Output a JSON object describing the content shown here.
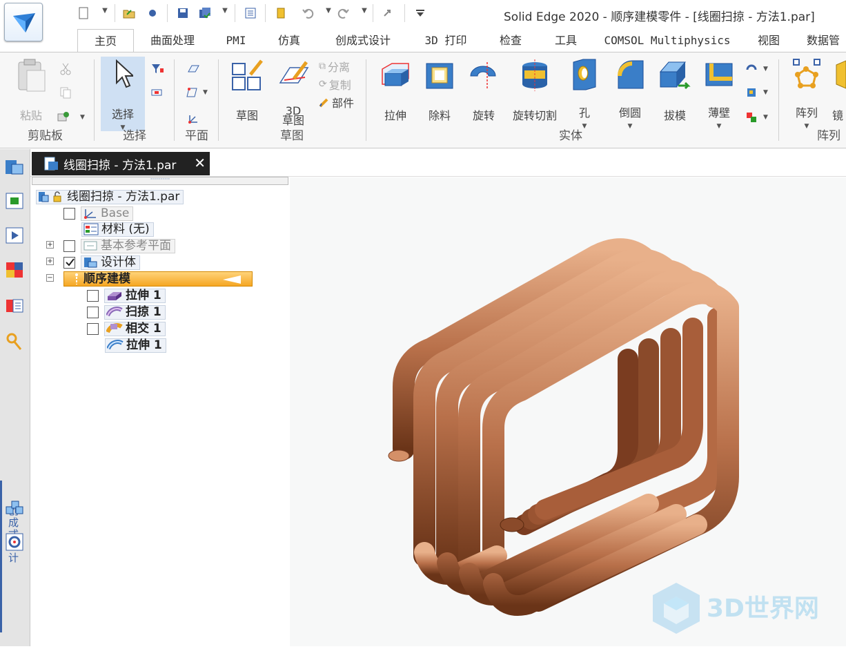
{
  "window": {
    "title": "Solid Edge 2020 - 顺序建模零件 - [线圈扫掠 - 方法1.par]"
  },
  "quick_access": [
    "new-icon",
    "open-icon",
    "print-icon",
    "save-icon",
    "save-all-icon",
    "properties-icon",
    "file-icon",
    "undo-icon",
    "redo-icon",
    "customize-icon"
  ],
  "tabs": [
    "主页",
    "曲面处理",
    "PMI",
    "仿真",
    "创成式设计",
    "3D 打印",
    "检查",
    "工具",
    "COMSOL Multiphysics",
    "视图",
    "数据管"
  ],
  "ribbon": {
    "clipboard": {
      "paste": "粘贴",
      "group": "剪贴板"
    },
    "select": {
      "select": "选择",
      "group": "选择"
    },
    "plane": {
      "group": "平面"
    },
    "sketch": {
      "sketch": "草图",
      "sketch3d_line1": "3D",
      "sketch3d_line2": "草图",
      "group": "草图",
      "separate": "分离",
      "copy": "复制",
      "part": "部件"
    },
    "solid": {
      "extrude": "拉伸",
      "cut": "除料",
      "revolve": "旋转",
      "revolve_cut": "旋转切割",
      "hole": "孔",
      "round": "倒圆",
      "draft": "拔模",
      "thin_wall": "薄壁",
      "group": "实体"
    },
    "pattern": {
      "pattern": "阵列",
      "group": "阵列",
      "mirror_partial": "镜"
    }
  },
  "left_dock": {
    "vertical_label": "创成式设计"
  },
  "document_tab": {
    "label": "线圈扫掠 - 方法1.par",
    "close": "✕"
  },
  "pathfinder": {
    "root": "线圈扫掠 - 方法1.par",
    "items": [
      {
        "label": "Base",
        "checked": false
      },
      {
        "label": "材料 (无)"
      },
      {
        "label": "基本参考平面",
        "checked": false
      },
      {
        "label": "设计体",
        "checked": true
      },
      {
        "label": "顺序建模"
      },
      {
        "label": "拉伸 1",
        "checked": false
      },
      {
        "label": "扫掠 1",
        "checked": false
      },
      {
        "label": "相交 1",
        "checked": false
      },
      {
        "label": "拉伸 1"
      }
    ]
  },
  "watermark": {
    "text": "3D世界网"
  },
  "colors": {
    "accent_orange": "#f5a623",
    "copper": "#c07850",
    "tab_dark": "#222222",
    "dock_blue": "#3a62a8"
  }
}
